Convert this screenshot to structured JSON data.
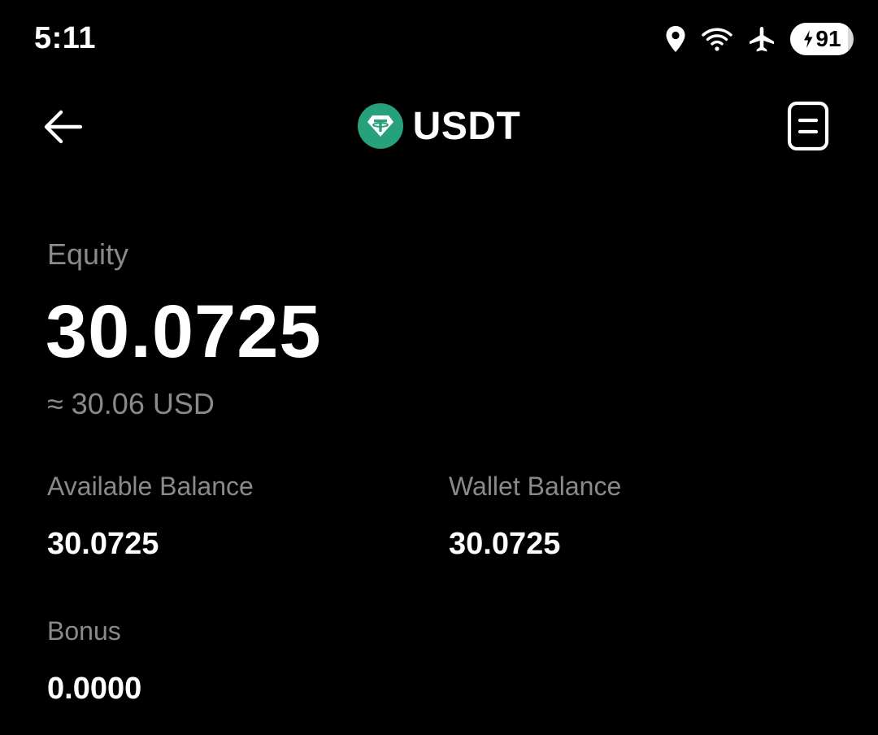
{
  "status_bar": {
    "time": "5:11",
    "battery_level": "91",
    "battery_fraction": 0.91,
    "icons": [
      "location-icon",
      "wifi-icon",
      "airplane-mode-icon",
      "battery-charging-icon"
    ]
  },
  "header": {
    "title": "USDT",
    "back_icon": "back-arrow-icon",
    "coin_icon": "tether-icon",
    "record_icon": "document-icon"
  },
  "equity": {
    "label": "Equity",
    "value": "30.0725",
    "usd_approx": "≈ 30.06 USD"
  },
  "balances": {
    "available_label": "Available Balance",
    "available_value": "30.0725",
    "wallet_label": "Wallet Balance",
    "wallet_value": "30.0725",
    "bonus_label": "Bonus",
    "bonus_value": "0.0000"
  },
  "colors": {
    "background": "#000000",
    "text_primary": "#ffffff",
    "text_secondary": "#8a8a8e",
    "tether_green": "#26a17b"
  }
}
